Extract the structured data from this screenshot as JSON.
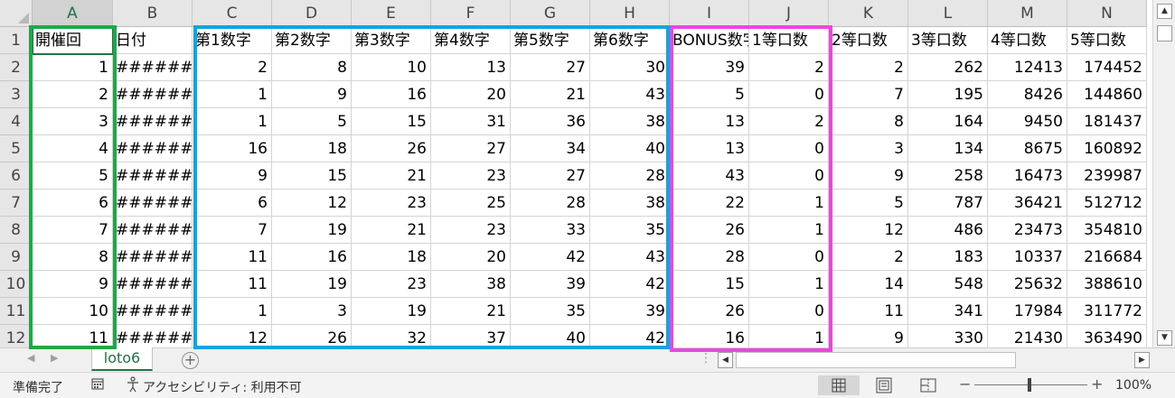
{
  "columns": [
    "A",
    "B",
    "C",
    "D",
    "E",
    "F",
    "G",
    "H",
    "I",
    "J",
    "K",
    "L",
    "M",
    "N"
  ],
  "row_numbers": [
    "1",
    "2",
    "3",
    "4",
    "5",
    "6",
    "7",
    "8",
    "9",
    "10",
    "11",
    "12"
  ],
  "headers": [
    "開催回",
    "日付",
    "第1数字",
    "第2数字",
    "第3数字",
    "第4数字",
    "第5数字",
    "第6数字",
    "BONUS数字",
    "1等口数",
    "2等口数",
    "3等口数",
    "4等口数",
    "5等口数"
  ],
  "rows": [
    [
      "1",
      "########",
      "2",
      "8",
      "10",
      "13",
      "27",
      "30",
      "39",
      "2",
      "2",
      "262",
      "12413",
      "174452"
    ],
    [
      "2",
      "########",
      "1",
      "9",
      "16",
      "20",
      "21",
      "43",
      "5",
      "0",
      "7",
      "195",
      "8426",
      "144860"
    ],
    [
      "3",
      "########",
      "1",
      "5",
      "15",
      "31",
      "36",
      "38",
      "13",
      "2",
      "8",
      "164",
      "9450",
      "181437"
    ],
    [
      "4",
      "########",
      "16",
      "18",
      "26",
      "27",
      "34",
      "40",
      "13",
      "0",
      "3",
      "134",
      "8675",
      "160892"
    ],
    [
      "5",
      "########",
      "9",
      "15",
      "21",
      "23",
      "27",
      "28",
      "43",
      "0",
      "9",
      "258",
      "16473",
      "239987"
    ],
    [
      "6",
      "########",
      "6",
      "12",
      "23",
      "25",
      "28",
      "38",
      "22",
      "1",
      "5",
      "787",
      "36421",
      "512712"
    ],
    [
      "7",
      "########",
      "7",
      "19",
      "21",
      "23",
      "33",
      "35",
      "26",
      "1",
      "12",
      "486",
      "23473",
      "354810"
    ],
    [
      "8",
      "########",
      "11",
      "16",
      "18",
      "20",
      "42",
      "43",
      "28",
      "0",
      "2",
      "183",
      "10337",
      "216684"
    ],
    [
      "9",
      "########",
      "11",
      "19",
      "23",
      "38",
      "39",
      "42",
      "15",
      "1",
      "14",
      "548",
      "25632",
      "388610"
    ],
    [
      "10",
      "########",
      "1",
      "3",
      "19",
      "21",
      "35",
      "39",
      "26",
      "0",
      "11",
      "341",
      "17984",
      "311772"
    ],
    [
      "11",
      "########",
      "12",
      "26",
      "32",
      "37",
      "40",
      "42",
      "16",
      "1",
      "9",
      "330",
      "21430",
      "363490"
    ]
  ],
  "sheet_tab": "loto6",
  "add_sheet": "+",
  "status": {
    "ready": "準備完了",
    "accessibility": "アクセシビリティ: 利用不可",
    "zoom": "100%",
    "zoom_minus": "−",
    "zoom_plus": "+"
  },
  "scroll": {
    "up": "▲",
    "down": "▼",
    "left": "◀",
    "right": "▶",
    "tab_prev": "◀",
    "tab_next": "▶",
    "dots": "⋮"
  },
  "highlights": {
    "green": "#1fa84a",
    "blue": "#11a4e5",
    "pink": "#ee44e0"
  },
  "accent_color": "#217346"
}
